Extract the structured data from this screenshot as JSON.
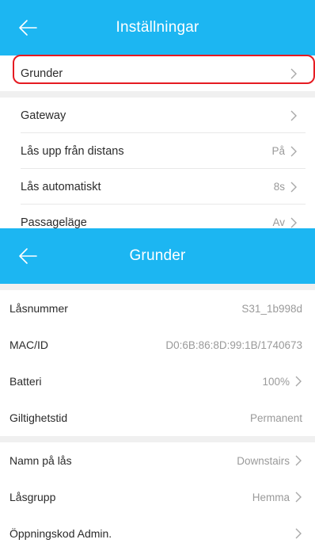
{
  "top_screen": {
    "header": {
      "title": "Inställningar",
      "back_icon": "arrow-left-icon"
    },
    "items": [
      {
        "label": "Grunder",
        "value": ""
      },
      {
        "label": "Gateway",
        "value": ""
      },
      {
        "label": "Lås upp från distans",
        "value": "På"
      },
      {
        "label": "Lås automatiskt",
        "value": "8s"
      },
      {
        "label": "Passageläge",
        "value": "Av"
      }
    ],
    "highlight_color": "#e51b22"
  },
  "bottom_screen": {
    "header": {
      "title": "Grunder",
      "back_icon": "arrow-left-icon"
    },
    "info_items": [
      {
        "label": "Låsnummer",
        "value": "S31_1b998d"
      },
      {
        "label": "MAC/ID",
        "value": "D0:6B:86:8D:99:1B/1740673"
      },
      {
        "label": "Batteri",
        "value": "100%"
      },
      {
        "label": "Giltighetstid",
        "value": "Permanent"
      }
    ],
    "settings_items": [
      {
        "label": "Namn på lås",
        "value": "Downstairs"
      },
      {
        "label": "Låsgrupp",
        "value": "Hemma"
      },
      {
        "label": "Öppningskod Admin.",
        "value": ""
      }
    ]
  },
  "colors": {
    "header_bg": "#1cb6f2",
    "header_text": "#ffffff",
    "value_text": "#9a9a9a"
  }
}
